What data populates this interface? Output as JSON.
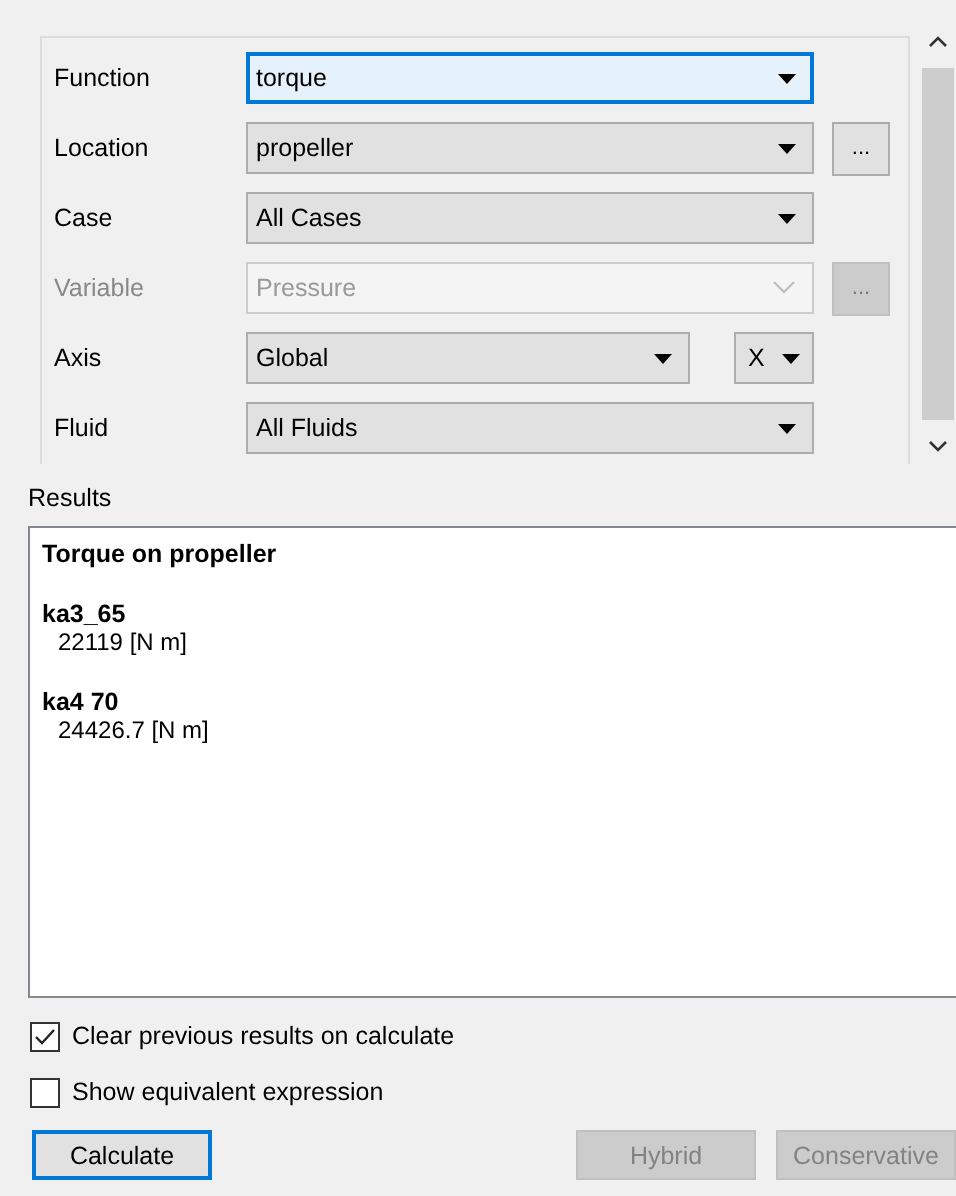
{
  "fields": [
    {
      "label": "Function",
      "value": "torque",
      "focused": true,
      "disabled": false
    },
    {
      "label": "Location",
      "value": "propeller",
      "focused": false,
      "disabled": false,
      "more": {
        "label": "...",
        "disabled": false
      }
    },
    {
      "label": "Case",
      "value": "All Cases",
      "focused": false,
      "disabled": false
    },
    {
      "label": "Variable",
      "value": "Pressure",
      "focused": false,
      "disabled": true,
      "more": {
        "label": "...",
        "disabled": true
      }
    },
    {
      "label": "Axis",
      "value": "Global",
      "focused": false,
      "disabled": false,
      "component": "X"
    },
    {
      "label": "Fluid",
      "value": "All Fluids",
      "focused": false,
      "disabled": false
    }
  ],
  "results": {
    "label": "Results",
    "title": "Torque on propeller",
    "entries": [
      {
        "name": "ka3_65",
        "value": "22119 [N m]"
      },
      {
        "name": "ka4 70",
        "value": "24426.7 [N m]"
      }
    ]
  },
  "options": [
    {
      "label": "Clear previous results on calculate",
      "checked": true
    },
    {
      "label": "Show equivalent expression",
      "checked": false
    }
  ],
  "buttons": [
    {
      "label": "Calculate",
      "focused": true,
      "disabled": false
    },
    {
      "label": "Hybrid",
      "focused": false,
      "disabled": true
    },
    {
      "label": "Conservative",
      "focused": false,
      "disabled": true
    }
  ]
}
